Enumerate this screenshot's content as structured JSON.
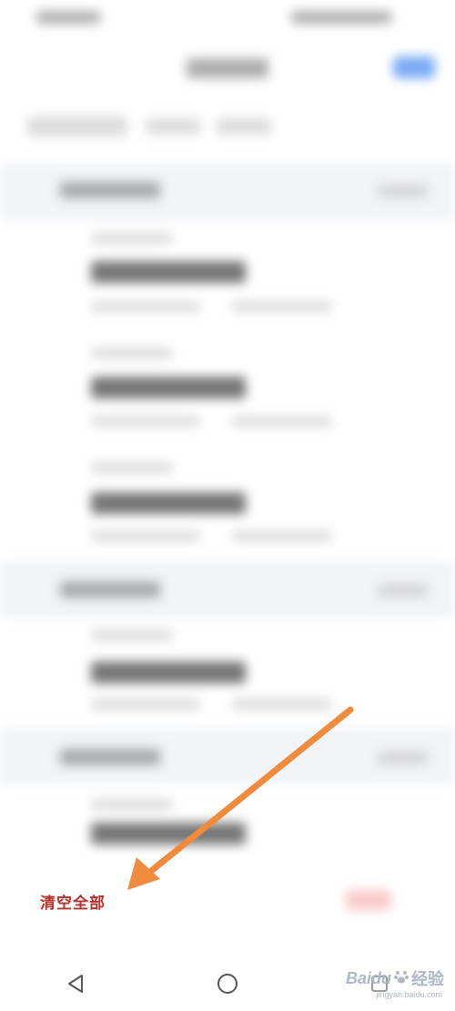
{
  "overlay": {
    "clear_all_label": "清空全部",
    "arrow_color": "#f08a3c"
  },
  "nav": {
    "back_icon": "back-triangle-icon",
    "home_icon": "home-circle-icon",
    "recents_icon": "recents-square-icon"
  },
  "watermark": {
    "brand": "Baidu",
    "sub": "jingyan.baidu.com",
    "word": "经验"
  },
  "colors": {
    "accent_blue": "#4a8ef0",
    "label_red": "#b8302a",
    "header_gray": "#f1f3f6"
  }
}
